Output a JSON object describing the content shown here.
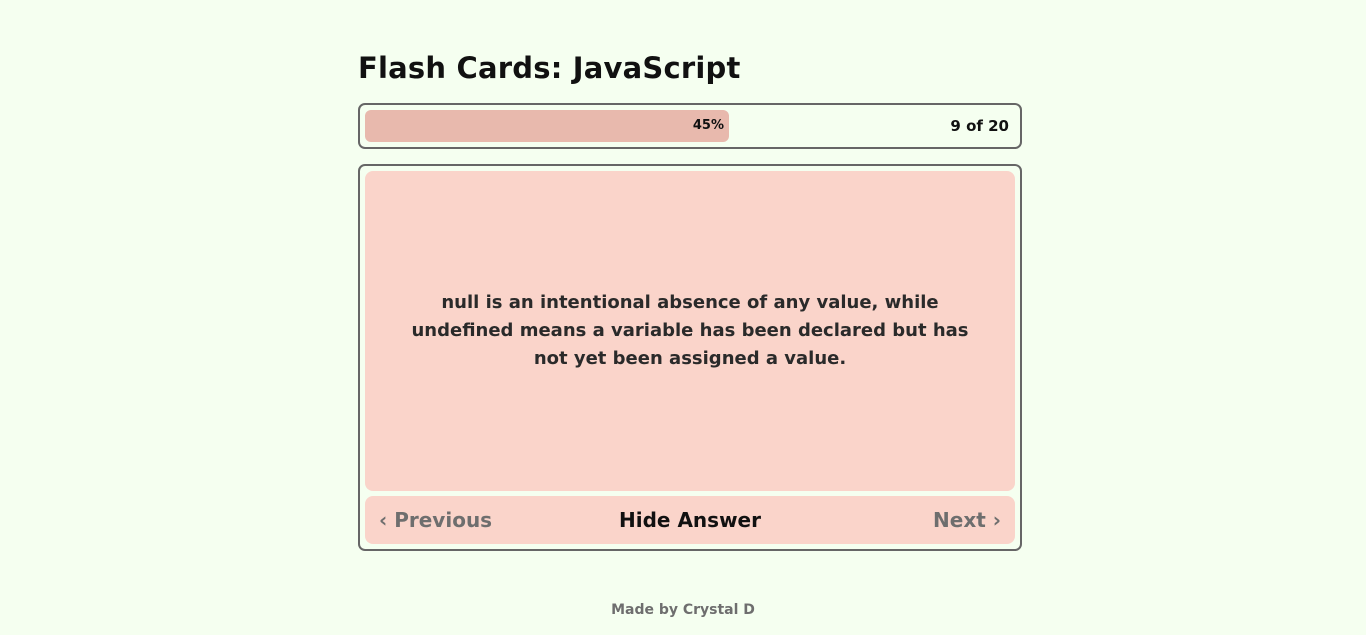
{
  "header": {
    "title": "Flash Cards: JavaScript"
  },
  "progress": {
    "percent_label": "45%",
    "fraction": 0.45,
    "count_label": "9 of 20",
    "bar_color": "#e8b9ad"
  },
  "card": {
    "answer_text": "null is an intentional absence of any value, while undefined means a variable has been declared but has not yet been assigned a value.",
    "background": "#fad4ca"
  },
  "controls": {
    "previous_label": "Previous",
    "previous_icon": "chevron-left-icon",
    "toggle_label": "Hide Answer",
    "next_label": "Next",
    "next_icon": "chevron-right-icon"
  },
  "footer": {
    "credit": "Made by Crystal D"
  },
  "colors": {
    "page_background": "#f5fff0",
    "border": "#666666"
  }
}
